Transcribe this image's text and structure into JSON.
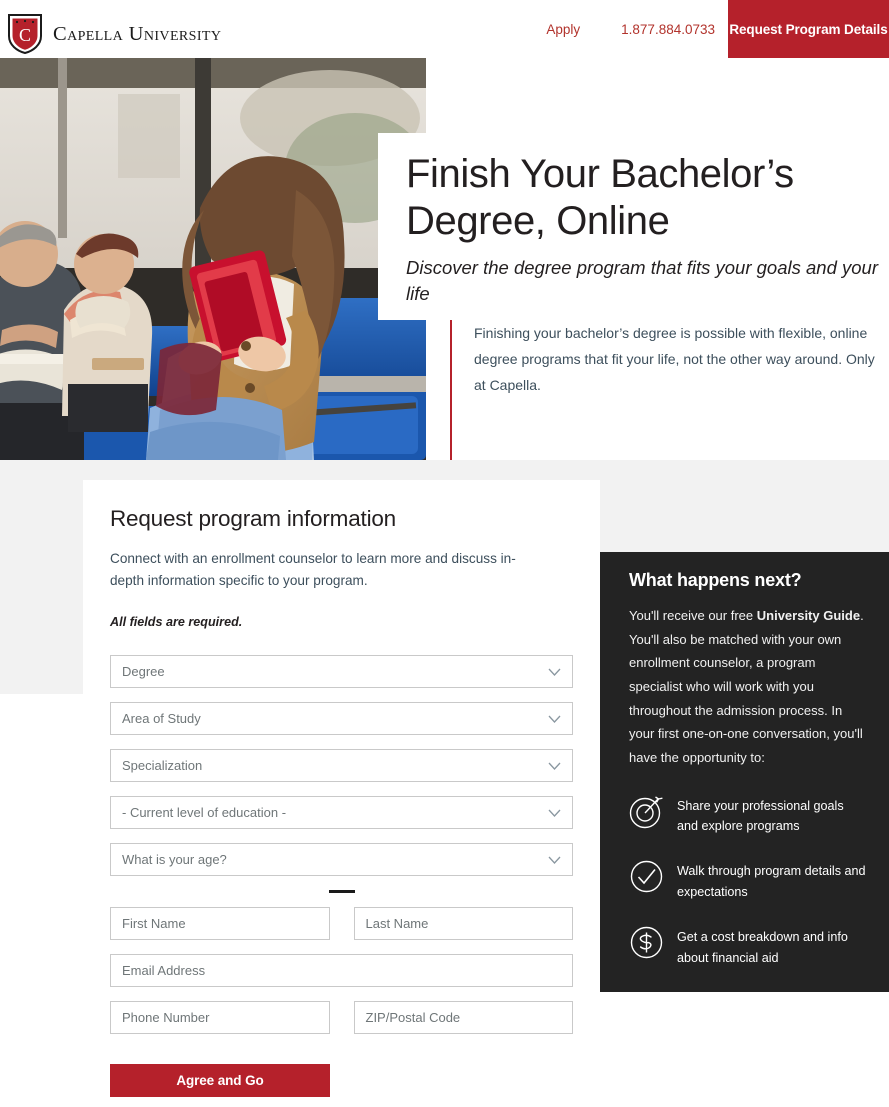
{
  "header": {
    "logo_text": "Capella University",
    "logo_icon": "capella-shield-icon",
    "apply_label": "Apply",
    "phone": "1.877.884.0733",
    "cta_label": "Request Program Details"
  },
  "hero": {
    "heading": "Finish Your Bachelor’s Degree, Online",
    "subheading": "Discover the degree program that fits your goals and your life",
    "quote": "Finishing your bachelor’s degree is possible with flexible, online degree programs that fit your life, not the other way around. Only at Capella.",
    "photo_alt": "woman-reading-tablet-on-bus-photo"
  },
  "form": {
    "title": "Request program information",
    "description": "Connect with an enrollment counselor to learn more and discuss in-depth information specific to your program.",
    "required_note": "All fields are required.",
    "selects": [
      {
        "name": "degree",
        "value": "Degree"
      },
      {
        "name": "area-of-study",
        "value": "Area of Study"
      },
      {
        "name": "specialization",
        "value": "Specialization"
      },
      {
        "name": "education-level",
        "value": "- Current level of education -"
      },
      {
        "name": "age",
        "value": "What is your age?"
      }
    ],
    "inputs": {
      "first_name": "First Name",
      "last_name": "Last Name",
      "email": "Email Address",
      "phone": "Phone Number",
      "zip": "ZIP/Postal Code"
    },
    "submit_label": "Agree and Go"
  },
  "next_panel": {
    "title": "What happens next?",
    "body_part1": "You'll receive our free ",
    "body_bold": "University Guide",
    "body_part2": ". You'll also be matched with your own enrollment counselor, a program specialist who will work with you throughout the admission process. In your first one-on-one conversation, you'll have the opportunity to:",
    "benefits": [
      {
        "icon": "target-icon",
        "text": "Share your professional goals and explore programs"
      },
      {
        "icon": "check-circle-icon",
        "text": "Walk through program details and expectations"
      },
      {
        "icon": "dollar-circle-icon",
        "text": "Get a cost breakdown and info about financial aid"
      }
    ]
  },
  "colors": {
    "brand_red": "#b5212b",
    "link_red": "#b2332c",
    "dark_panel": "#232323",
    "page_gray": "#f2f2f2",
    "body_text": "#3d4f5c"
  }
}
